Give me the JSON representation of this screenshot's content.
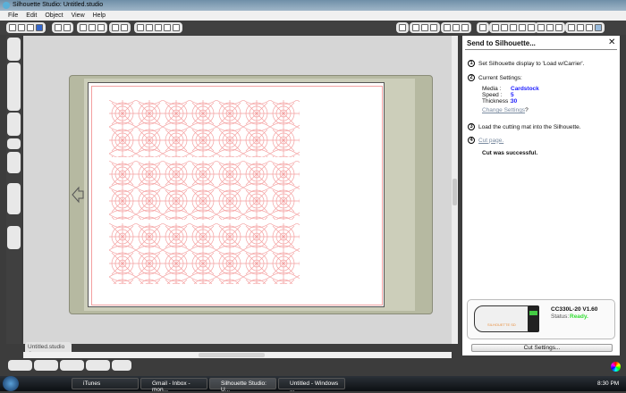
{
  "window": {
    "title": "Silhouette Studio: Untitled.studio"
  },
  "menu": [
    "File",
    "Edit",
    "Object",
    "View",
    "Help"
  ],
  "panel": {
    "title": "Send to Silhouette...",
    "steps": [
      {
        "n": "1",
        "text": "Set Silhouette display to 'Load w/Carrier'."
      },
      {
        "n": "2",
        "text": "Current Settings:"
      },
      {
        "n": "3",
        "text": "Load the cutting mat into the Silhouette."
      },
      {
        "n": "4",
        "text": "Cut page."
      }
    ],
    "settings": [
      {
        "label": "Media :",
        "value": "Cardstock"
      },
      {
        "label": "Speed :",
        "value": "5"
      },
      {
        "label": "Thickness :",
        "value": "30"
      }
    ],
    "change_settings": "Change Settings",
    "change_suffix": "?",
    "result": "Cut was successful.",
    "device_model": "CC330L-20 V1.60",
    "status_label": "Status:",
    "status_value": "Ready.",
    "device_brand": "SILHOUETTE SD",
    "cut_settings_button": "Cut Settings..."
  },
  "document_tab": "Untitled.studio",
  "colors": {
    "pattern": "#f4a0a0",
    "status_ready": "#33dd33",
    "setting_value": "#1a1aff",
    "mat": "#b6b9a1"
  },
  "taskbar": {
    "items": [
      "iTunes",
      "Gmail - Inbox - mon...",
      "Silhouette Studio: U...",
      "Untitled - Windows ..."
    ],
    "clock": "8:30 PM"
  }
}
